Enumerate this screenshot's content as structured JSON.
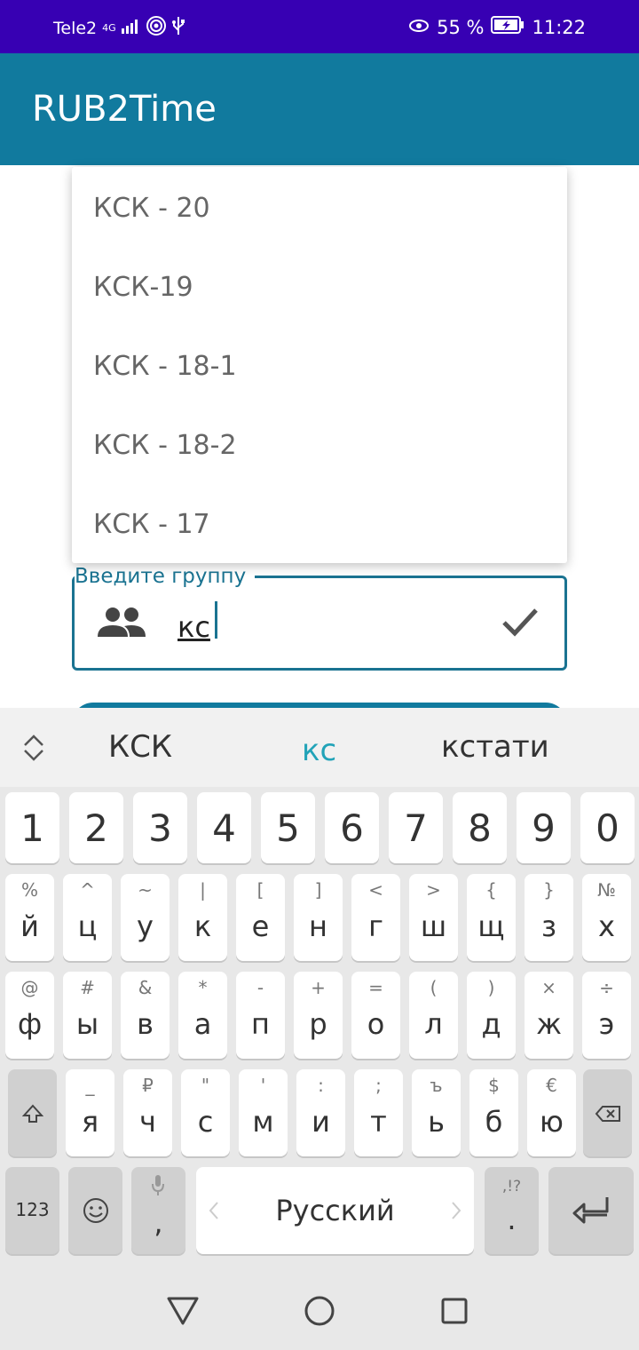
{
  "status_bar": {
    "carrier": "Tele2",
    "network": "4G",
    "battery": "55 %",
    "time": "11:22"
  },
  "app": {
    "title": "RUB2Time"
  },
  "dropdown": {
    "items": [
      "КСК - 20",
      "КСК-19",
      "КСК - 18-1",
      "КСК - 18-2",
      "КСК - 17"
    ]
  },
  "group_field": {
    "label": "Введите группу",
    "value": "кс",
    "icon": "group-icon",
    "end_icon": "check-icon"
  },
  "suggestions": {
    "left": "КСК",
    "middle": "кс",
    "right": "кстати"
  },
  "keyboard": {
    "numbers": [
      "1",
      "2",
      "3",
      "4",
      "5",
      "6",
      "7",
      "8",
      "9",
      "0"
    ],
    "row1": {
      "keys": [
        "й",
        "ц",
        "у",
        "к",
        "е",
        "н",
        "г",
        "ш",
        "щ",
        "з",
        "х"
      ],
      "alt": [
        "%",
        "^",
        "~",
        "|",
        "[",
        "]",
        "<",
        ">",
        "{",
        "}",
        "№"
      ]
    },
    "row2": {
      "keys": [
        "ф",
        "ы",
        "в",
        "а",
        "п",
        "р",
        "о",
        "л",
        "д",
        "ж",
        "э"
      ],
      "alt": [
        "@",
        "#",
        "&",
        "*",
        "-",
        "+",
        "=",
        "(",
        ")",
        "×",
        "÷"
      ]
    },
    "row3": {
      "keys": [
        "я",
        "ч",
        "с",
        "м",
        "и",
        "т",
        "ь",
        "б",
        "ю"
      ],
      "alt": [
        "_",
        "₽",
        "\"",
        "'",
        ":",
        ";",
        "ъ",
        "$",
        "€"
      ]
    },
    "bottom": {
      "mode_key": "123",
      "emoji_icon": "emoji-icon",
      "comma_key": ",",
      "space_label": "Русский",
      "period_key": ".",
      "period_alt": ",!?",
      "mic_icon": "mic-icon",
      "shift_icon": "shift-icon",
      "backspace_icon": "backspace-icon",
      "enter_icon": "enter-icon"
    }
  },
  "colors": {
    "status_bar": "#3700B3",
    "app_bar": "#117A9E",
    "accent": "#1A7391",
    "suggestion_accent": "#22A3B8",
    "keyboard_bg": "#E8E8E8"
  }
}
